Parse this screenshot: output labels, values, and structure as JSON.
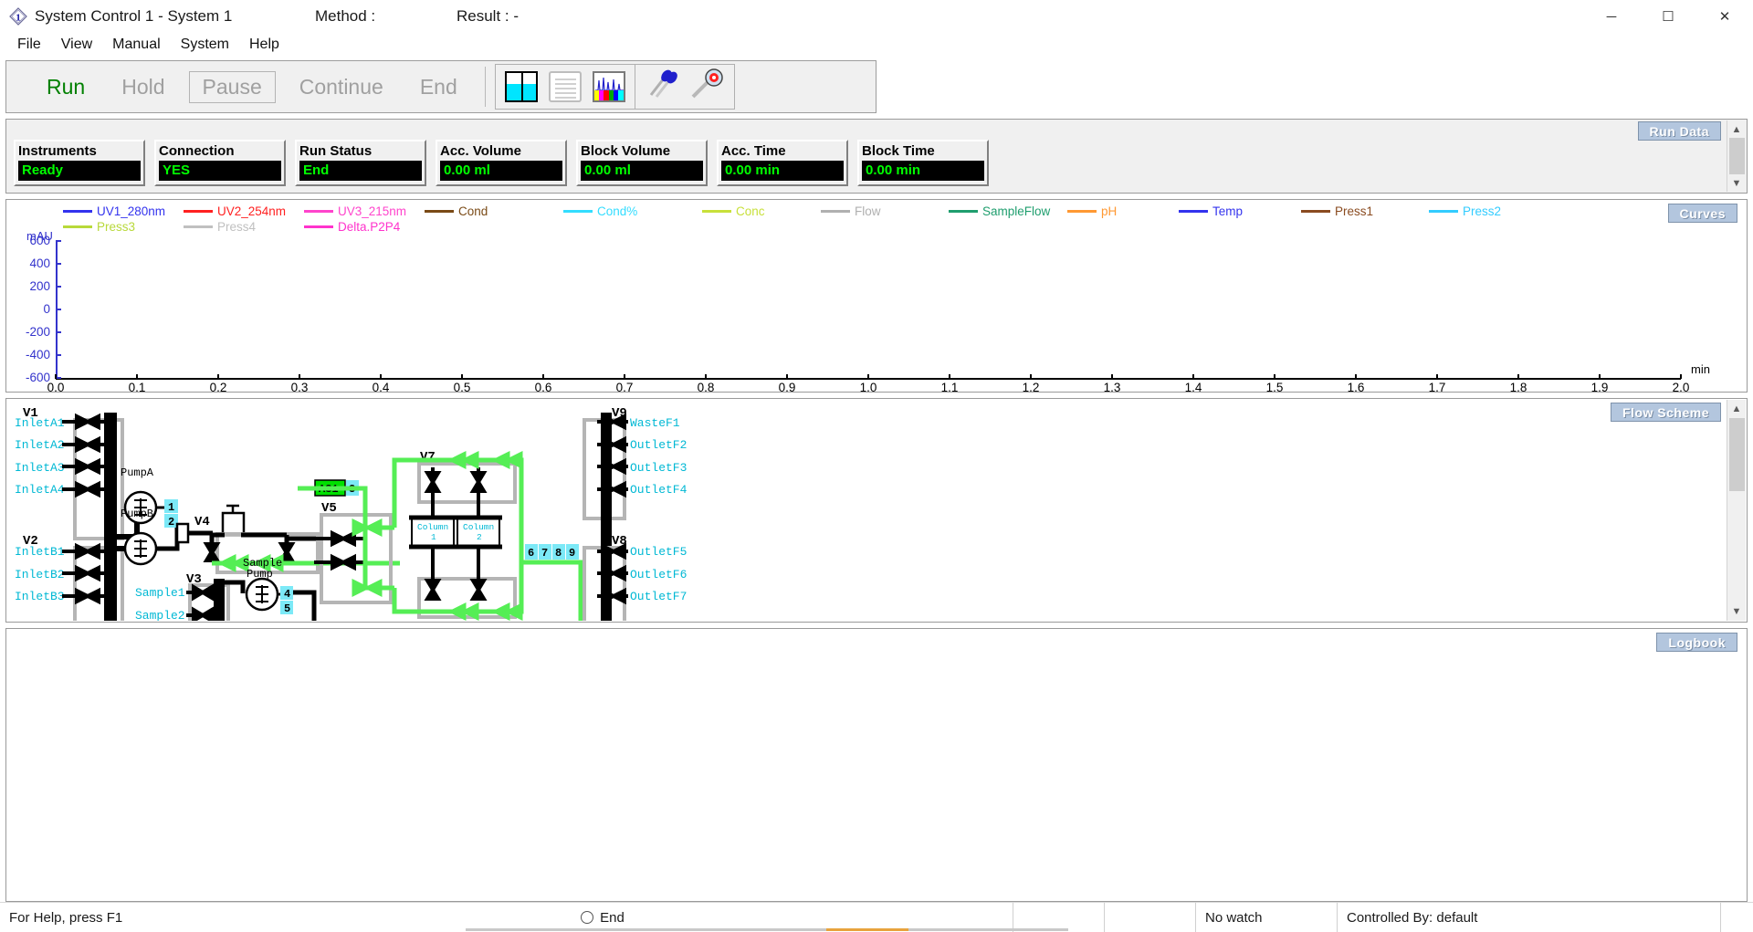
{
  "window": {
    "title": "System Control 1 - System 1",
    "method_label": "Method :",
    "result_label": "Result :  -",
    "icon": "unicorn-diamond-icon",
    "buttons": {
      "minimize": "─",
      "maximize": "☐",
      "close": "✕"
    }
  },
  "menu": {
    "items": [
      "File",
      "View",
      "Manual",
      "System",
      "Help"
    ]
  },
  "toolbar": {
    "run_label": "Run",
    "hold_label": "Hold",
    "pause_label": "Pause",
    "continue_label": "Continue",
    "end_label": "End",
    "icons": [
      "vessels-icon",
      "method-list-icon",
      "chromatogram-icon",
      "connect-probe-icon",
      "system-settings-icon"
    ]
  },
  "run_data": {
    "tab_label": "Run Data",
    "cells": [
      {
        "label": "Instruments",
        "value": "Ready"
      },
      {
        "label": "Connection",
        "value": "YES"
      },
      {
        "label": "Run Status",
        "value": "End"
      },
      {
        "label": "Acc. Volume",
        "value": "0.00  ml"
      },
      {
        "label": "Block Volume",
        "value": "0.00  ml"
      },
      {
        "label": "Acc. Time",
        "value": "0.00  min"
      },
      {
        "label": "Block Time",
        "value": "0.00  min"
      }
    ]
  },
  "curves": {
    "tab_label": "Curves",
    "legend": [
      {
        "label": "UV1_280nm",
        "color": "#3333ee"
      },
      {
        "label": "UV2_254nm",
        "color": "#ff2020"
      },
      {
        "label": "UV3_215nm",
        "color": "#ff44cc"
      },
      {
        "label": "Cond",
        "color": "#7a4a16"
      },
      {
        "label": "Cond%",
        "color": "#33ddff"
      },
      {
        "label": "Conc",
        "color": "#c8e03a"
      },
      {
        "label": "Flow",
        "color": "#b0b0b0"
      },
      {
        "label": "SampleFlow",
        "color": "#1f9e6e"
      },
      {
        "label": "pH",
        "color": "#ff9933"
      },
      {
        "label": "Temp",
        "color": "#3333ee"
      },
      {
        "label": "Press1",
        "color": "#8a4b20"
      },
      {
        "label": "Press2",
        "color": "#33ccff"
      },
      {
        "label": "Press3",
        "color": "#b8d93a"
      },
      {
        "label": "Press4",
        "color": "#c0c0c0"
      },
      {
        "label": "Delta.P2P4",
        "color": "#ff33cc"
      }
    ]
  },
  "chart_data": {
    "type": "line",
    "title": "",
    "xlabel": "min",
    "ylabel": "mAU",
    "xlim": [
      0.0,
      2.0
    ],
    "ylim": [
      -600,
      600
    ],
    "grid": false,
    "legend_position": "top",
    "y_ticks": [
      "600",
      "400",
      "200",
      "0",
      "-200",
      "-400",
      "-600"
    ],
    "x_ticks": [
      "0.0",
      "0.1",
      "0.2",
      "0.3",
      "0.4",
      "0.5",
      "0.6",
      "0.7",
      "0.8",
      "0.9",
      "1.0",
      "1.1",
      "1.2",
      "1.3",
      "1.4",
      "1.5",
      "1.6",
      "1.7",
      "1.8",
      "1.9",
      "2.0"
    ],
    "series": [
      {
        "name": "UV1_280nm",
        "color": "#3333ee",
        "values": []
      },
      {
        "name": "UV2_254nm",
        "color": "#ff2020",
        "values": []
      },
      {
        "name": "UV3_215nm",
        "color": "#ff44cc",
        "values": []
      },
      {
        "name": "Cond",
        "color": "#7a4a16",
        "values": []
      },
      {
        "name": "Cond%",
        "color": "#33ddff",
        "values": []
      },
      {
        "name": "Conc",
        "color": "#c8e03a",
        "values": []
      },
      {
        "name": "Flow",
        "color": "#b0b0b0",
        "values": []
      },
      {
        "name": "SampleFlow",
        "color": "#1f9e6e",
        "values": []
      },
      {
        "name": "pH",
        "color": "#ff9933",
        "values": []
      },
      {
        "name": "Temp",
        "color": "#3333ee",
        "values": []
      },
      {
        "name": "Press1",
        "color": "#8a4b20",
        "values": []
      },
      {
        "name": "Press2",
        "color": "#33ccff",
        "values": []
      },
      {
        "name": "Press3",
        "color": "#b8d93a",
        "values": []
      },
      {
        "name": "Press4",
        "color": "#c0c0c0",
        "values": []
      },
      {
        "name": "Delta.P2P4",
        "color": "#ff33cc",
        "values": []
      }
    ]
  },
  "flow_scheme": {
    "tab_label": "Flow Scheme",
    "valves": [
      "V1",
      "V2",
      "V3",
      "V4",
      "V5",
      "V7",
      "V8",
      "V9"
    ],
    "inlets_a": [
      "InletA1",
      "InletA2",
      "InletA3",
      "InletA4"
    ],
    "inlets_b": [
      "InletB1",
      "InletB2",
      "InletB3"
    ],
    "samples": [
      "Sample1",
      "Sample2"
    ],
    "pumps": [
      "PumpA",
      "PumpB",
      "Sample Pump"
    ],
    "pump_a_label": "PumpA",
    "pump_b_label": "PumpB",
    "sample_pump_label_1": "Sample",
    "sample_pump_label_2": "Pump",
    "columns": [
      {
        "name": "Column",
        "index": "1"
      },
      {
        "name": "Column",
        "index": "2"
      }
    ],
    "outlets_v9": [
      "WasteF1",
      "OutletF2",
      "OutletF3",
      "OutletF4"
    ],
    "outlets_v8": [
      "OutletF5",
      "OutletF6",
      "OutletF7"
    ],
    "port_markers": [
      "1",
      "2",
      "4",
      "5"
    ],
    "as1_label": "AS1",
    "as1_port": "3",
    "path_ports": [
      "6",
      "7",
      "8",
      "9"
    ],
    "active_path_color": "#55ee55"
  },
  "logbook": {
    "tab_label": "Logbook",
    "entries": []
  },
  "statusbar": {
    "help_text": "For Help, press F1",
    "run_state": "End",
    "watch": "No watch",
    "controlled_by": "Controlled By: default"
  }
}
